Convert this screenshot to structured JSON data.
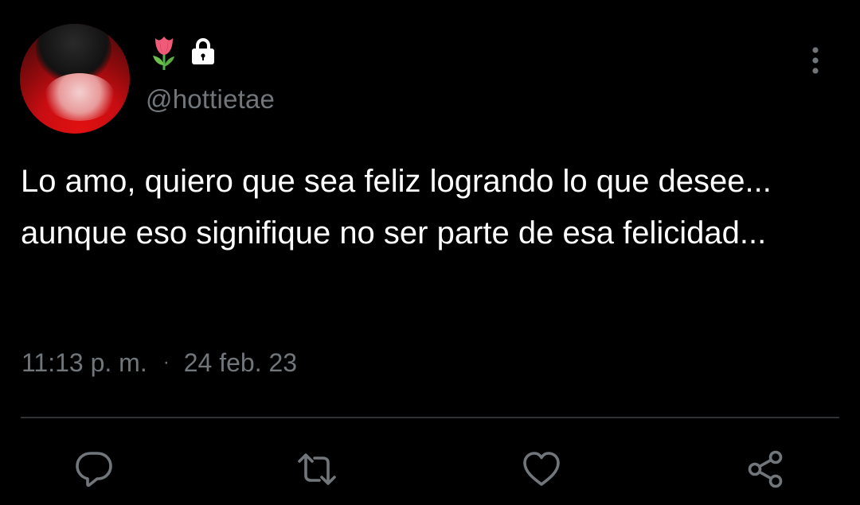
{
  "tweet": {
    "display_name_emoji": "tulip-icon",
    "protected_icon": "lock-icon",
    "handle": "@hottietae",
    "text": "Lo amo, quiero que sea feliz logrando lo que desee... aunque eso signifique no ser parte de esa felicidad...",
    "time": "11:13 p. m.",
    "separator": "·",
    "date": "24 feb. 23"
  },
  "actions": {
    "reply_icon": "reply-icon",
    "retweet_icon": "retweet-icon",
    "like_icon": "heart-icon",
    "share_icon": "share-icon",
    "more_icon": "more-vertical-icon"
  },
  "colors": {
    "background": "#000000",
    "text": "#ffffff",
    "secondary": "#71767b",
    "divider": "#2f3336",
    "avatar_red": "#c80d12"
  }
}
